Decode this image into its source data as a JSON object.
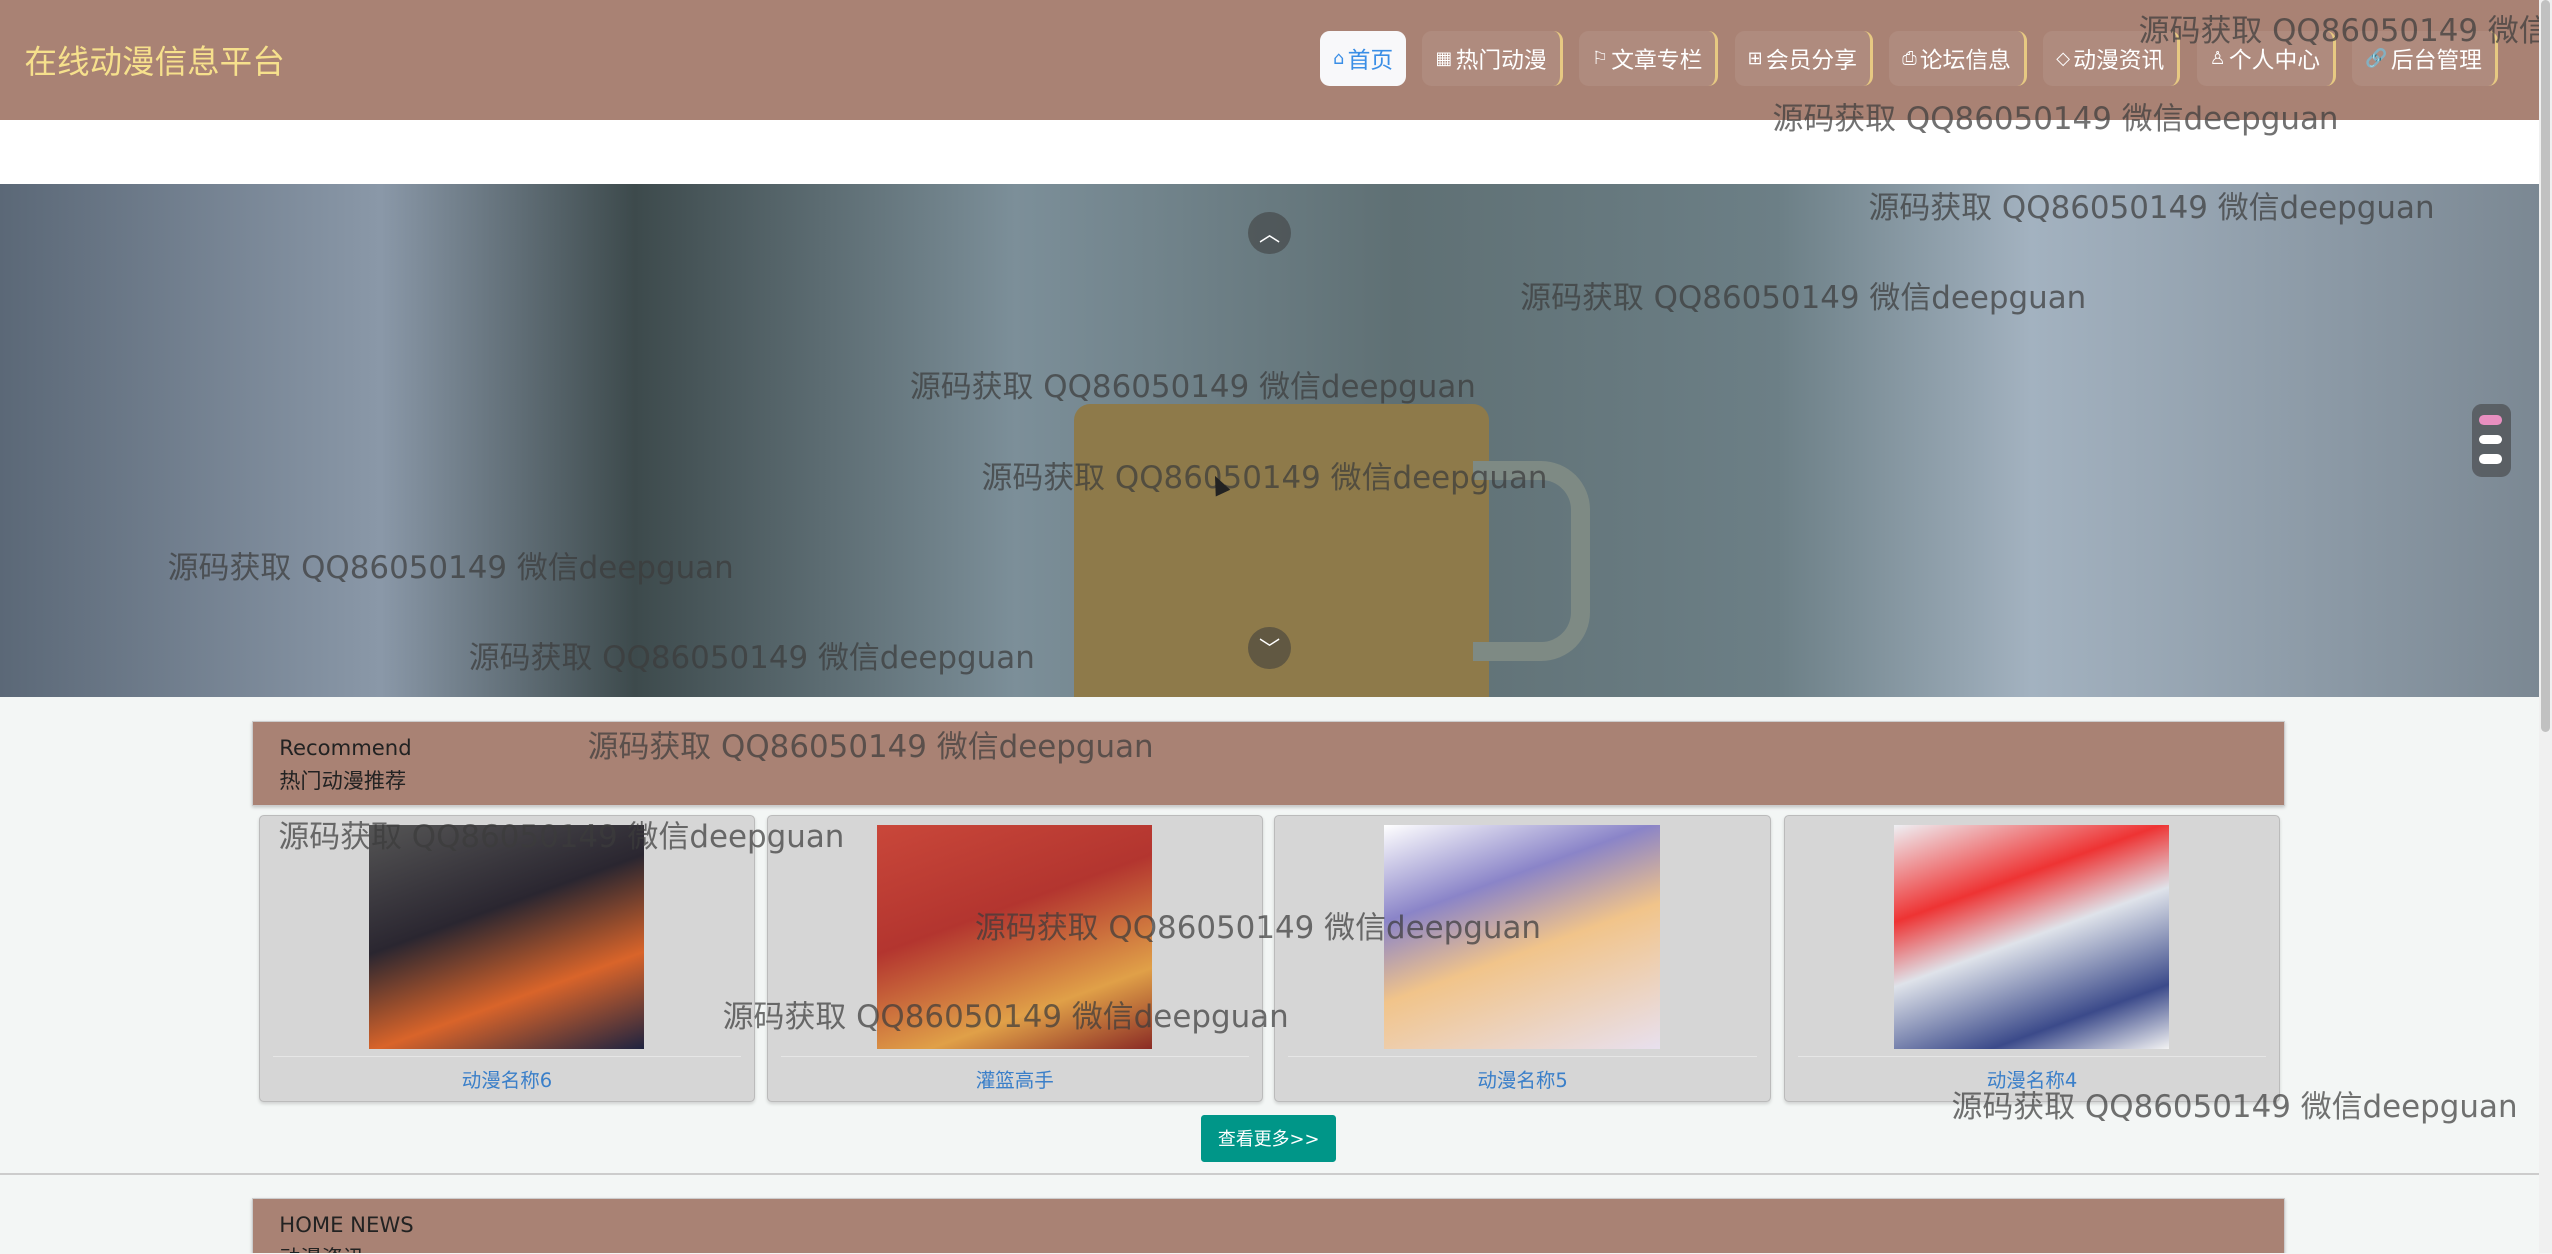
{
  "header": {
    "title": "在线动漫信息平台",
    "nav": [
      {
        "icon": "home-icon",
        "glyph": "⌂",
        "label": "首页",
        "active": true
      },
      {
        "icon": "grid-icon",
        "glyph": "▦",
        "label": "热门动漫"
      },
      {
        "icon": "flag-icon",
        "glyph": "⚐",
        "label": "文章专栏"
      },
      {
        "icon": "gift-icon",
        "glyph": "⊞",
        "label": "会员分享"
      },
      {
        "icon": "print-icon",
        "glyph": "⎙",
        "label": "论坛信息"
      },
      {
        "icon": "tag-icon",
        "glyph": "◇",
        "label": "动漫资讯"
      },
      {
        "icon": "user-icon",
        "glyph": "♙",
        "label": "个人中心"
      },
      {
        "icon": "link-icon",
        "glyph": "🔗",
        "label": "后台管理"
      }
    ]
  },
  "banner": {
    "up": "︿",
    "down": "﹀"
  },
  "recommend": {
    "en": "Recommend",
    "cn": "热门动漫推荐",
    "items": [
      {
        "name": "动漫名称6",
        "color": "#2a2630"
      },
      {
        "name": "灌篮高手",
        "color": "#b3352f"
      },
      {
        "name": "动漫名称5",
        "color": "#e8e0ee"
      },
      {
        "name": "动漫名称4",
        "color": "#dfe3ea"
      }
    ],
    "more": "查看更多>>"
  },
  "news": {
    "en": "HOME NEWS",
    "cn": "动漫资讯"
  },
  "watermark": "源码获取 QQ86050149 微信deepguan"
}
